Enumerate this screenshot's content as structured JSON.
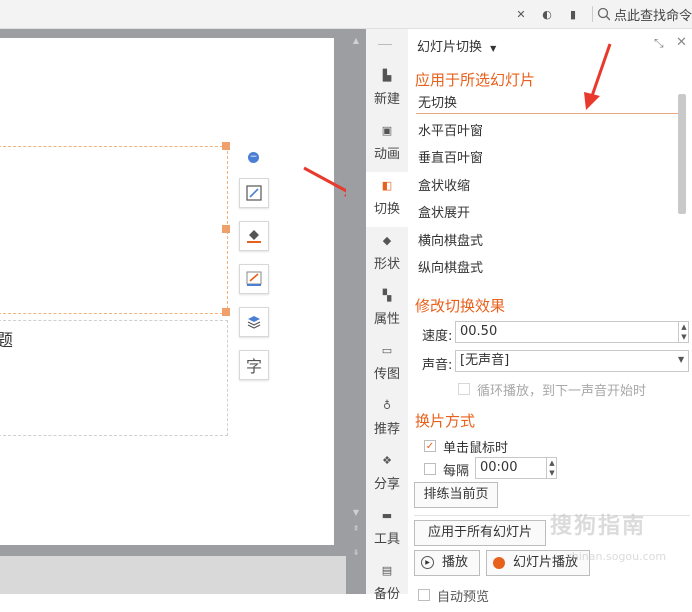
{
  "search": {
    "label": "点此查找命令"
  },
  "rail": {
    "items": [
      {
        "label": "新建",
        "icon": "new-slide-icon"
      },
      {
        "label": "动画",
        "icon": "animation-icon"
      },
      {
        "label": "切换",
        "icon": "transition-icon"
      },
      {
        "label": "形状",
        "icon": "shapes-icon"
      },
      {
        "label": "属性",
        "icon": "properties-icon"
      },
      {
        "label": "传图",
        "icon": "upload-image-icon"
      },
      {
        "label": "推荐",
        "icon": "recommend-icon"
      },
      {
        "label": "分享",
        "icon": "share-icon"
      },
      {
        "label": "工具",
        "icon": "toolbox-icon"
      },
      {
        "label": "备份",
        "icon": "backup-icon"
      }
    ]
  },
  "panel": {
    "title": "幻灯片切换",
    "apply_section": "应用于所选幻灯片",
    "transitions": [
      "无切换",
      "水平百叶窗",
      "垂直百叶窗",
      "盒状收缩",
      "盒状展开",
      "横向棋盘式",
      "纵向棋盘式"
    ],
    "modify_section": "修改切换效果",
    "speed_label": "速度:",
    "speed_value": "00.50",
    "sound_label": "声音:",
    "sound_value": "[无声音]",
    "loop_label": "循环播放，到下一声音开始时",
    "advance_section": "换片方式",
    "on_click_label": "单击鼠标时",
    "on_click_checked": true,
    "every_label": "每隔",
    "every_value": "00:00",
    "rehearse_button": "排练当前页",
    "apply_all_button": "应用于所有幻灯片",
    "play_button": "播放",
    "slideshow_button": "幻灯片播放",
    "autopreview_label": "自动预览"
  },
  "slide": {
    "text_fragment": "题"
  },
  "watermark": {
    "text": "搜狗指南",
    "sub": "zhinan.sogou.com"
  },
  "colors": {
    "accent": "#e8611c",
    "arrow": "#e8392c"
  }
}
